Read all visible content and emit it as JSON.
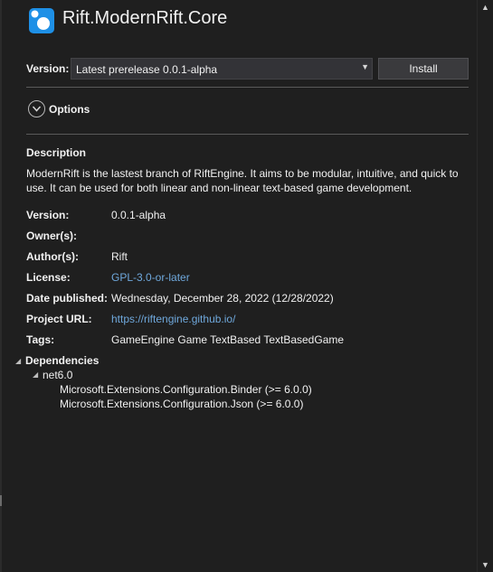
{
  "package": {
    "title": "Rift.ModernRift.Core",
    "icon": "nuget-package-icon"
  },
  "version_row": {
    "label": "Version:",
    "selected": "Latest prerelease 0.0.1-alpha",
    "install_label": "Install"
  },
  "options": {
    "label": "Options"
  },
  "description": {
    "heading": "Description",
    "text": "ModernRift is the lastest branch of RiftEngine. It aims to be modular, intuitive, and quick to use. It can be used for both linear and non-linear text-based game development."
  },
  "details": [
    {
      "label": "Version:",
      "value": "0.0.1-alpha",
      "link": false
    },
    {
      "label": "Owner(s):",
      "value": "",
      "link": false
    },
    {
      "label": "Author(s):",
      "value": "Rift",
      "link": false
    },
    {
      "label": "License:",
      "value": "GPL-3.0-or-later",
      "link": true
    },
    {
      "label": "Date published:",
      "value": "Wednesday, December 28, 2022 (12/28/2022)",
      "link": false
    },
    {
      "label": "Project URL:",
      "value": "https://riftengine.github.io/",
      "link": true
    },
    {
      "label": "Tags:",
      "value": "GameEngine Game TextBased TextBasedGame",
      "link": false
    }
  ],
  "dependencies": {
    "heading": "Dependencies",
    "framework": "net6.0",
    "items": [
      "Microsoft.Extensions.Configuration.Binder (>= 6.0.0)",
      "Microsoft.Extensions.Configuration.Json (>= 6.0.0)"
    ]
  },
  "colors": {
    "background": "#1f1f1f",
    "link": "#6fa8dc",
    "icon_blue": "#1e90e6"
  }
}
